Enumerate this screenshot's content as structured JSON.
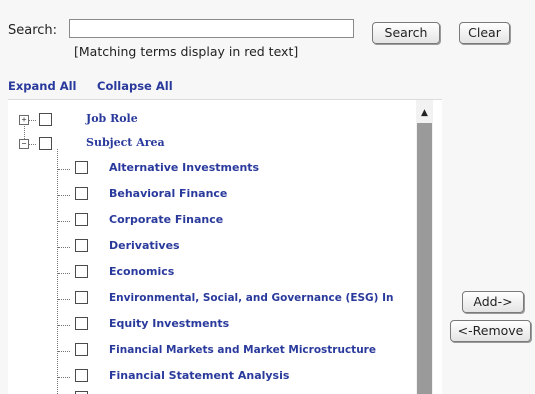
{
  "search": {
    "label": "Search:",
    "value": "",
    "hint": "[Matching terms display in red text]",
    "search_button": "Search",
    "clear_button": "Clear"
  },
  "tree_controls": {
    "expand_all": "Expand All",
    "collapse_all": "Collapse All"
  },
  "tree": {
    "root_nodes": [
      {
        "label": "Job Role",
        "expanded": false
      },
      {
        "label": "Subject Area",
        "expanded": true
      }
    ],
    "subject_area_children": [
      "Alternative Investments",
      "Behavioral Finance",
      "Corporate Finance",
      "Derivatives",
      "Economics",
      "Environmental, Social, and Governance (ESG) In",
      "Equity Investments",
      "Financial Markets and Market Microstructure",
      "Financial Statement Analysis"
    ]
  },
  "transfer": {
    "add_button": "Add->",
    "remove_button": "<-Remove"
  },
  "icons": {
    "expand": "plus-box-icon",
    "collapse": "minus-box-icon",
    "scroll_up": "triangle-up-icon"
  }
}
